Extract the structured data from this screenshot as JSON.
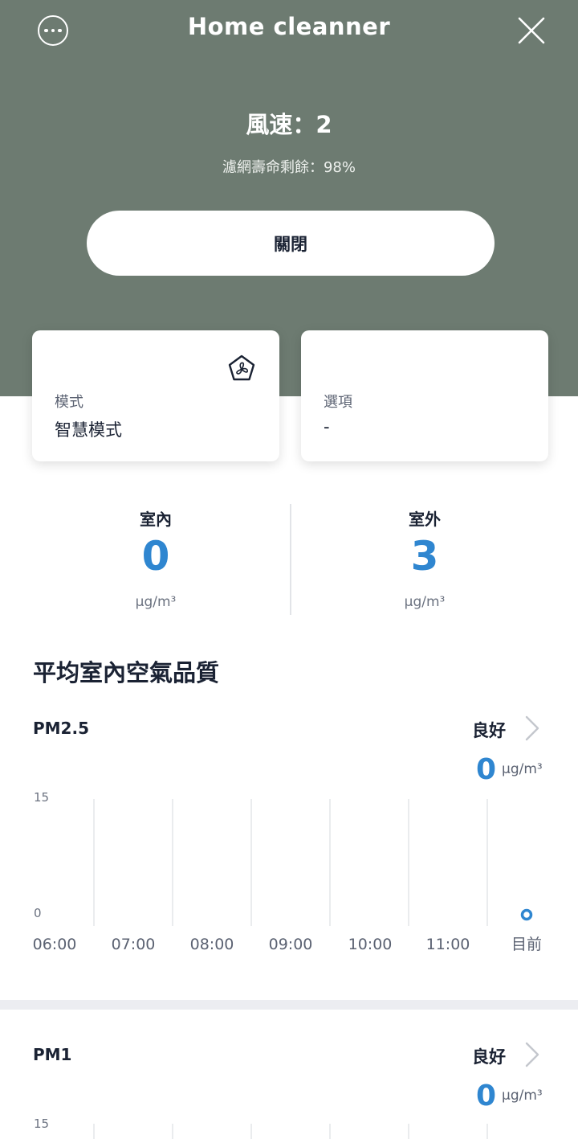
{
  "header": {
    "title": "Home cleanner",
    "fan_speed": "風速：2",
    "filter_life": "濾網壽命剩餘：98%",
    "power_button": "關閉",
    "bg_color": "#6d7b71",
    "more_icon": "more-dots-icon",
    "close_icon": "close-icon"
  },
  "cards": {
    "mode": {
      "label": "模式",
      "value": "智慧模式",
      "icon": "fan-mode-icon"
    },
    "options": {
      "label": "選項",
      "value": "-"
    }
  },
  "air_quality": {
    "indoor": {
      "label": "室內",
      "value": "0",
      "unit": "µg/m³"
    },
    "outdoor": {
      "label": "室外",
      "value": "3",
      "unit": "µg/m³"
    }
  },
  "section_title": "平均室內空氣品質",
  "metrics": [
    {
      "name": "PM2.5",
      "status": "良好",
      "value": "0",
      "unit": "µg/m³",
      "chart": {
        "y_max_label": "15",
        "y_min_label": "0",
        "categories": [
          "06:00",
          "07:00",
          "08:00",
          "09:00",
          "10:00",
          "11:00",
          "目前"
        ],
        "point": {
          "category": "目前",
          "value": 0
        }
      }
    },
    {
      "name": "PM1",
      "status": "良好",
      "value": "0",
      "unit": "µg/m³",
      "chart": {
        "y_max_label": "15"
      }
    }
  ],
  "chart_data": {
    "type": "scatter",
    "title": "PM2.5",
    "categories": [
      "06:00",
      "07:00",
      "08:00",
      "09:00",
      "10:00",
      "11:00",
      "目前"
    ],
    "series": [
      {
        "values": [
          null,
          null,
          null,
          null,
          null,
          null,
          0
        ]
      }
    ],
    "ylim": [
      0,
      15
    ],
    "yticks": [
      "0",
      "15"
    ],
    "grid": "vertical",
    "accent_color": "#2f86d0"
  }
}
